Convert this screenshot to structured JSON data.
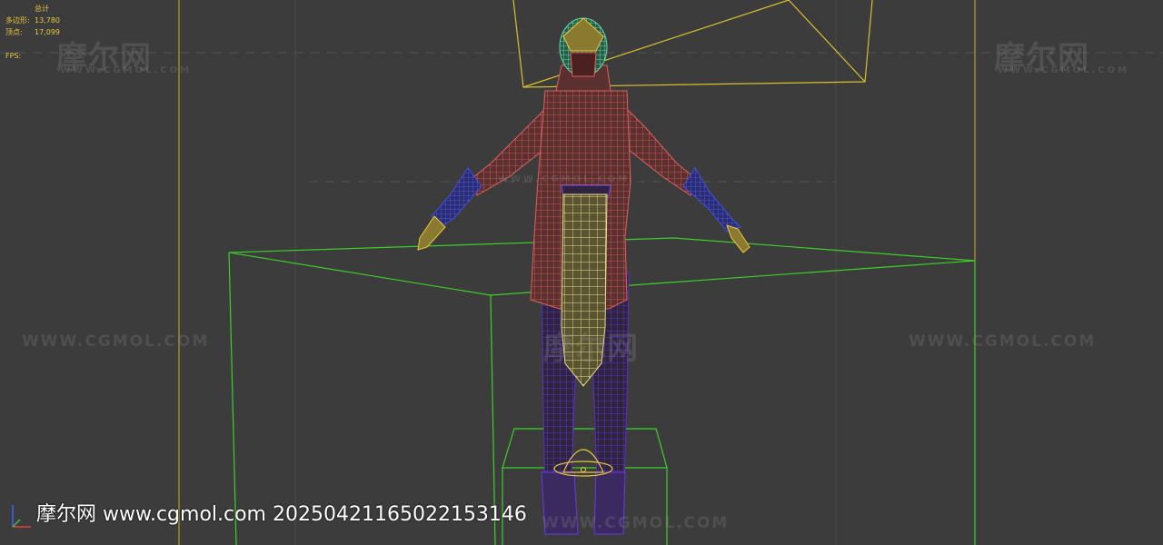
{
  "stats": {
    "header": "总计",
    "polygons_label": "多边形:",
    "polygons_value": "13,780",
    "vertices_label": "顶点:",
    "vertices_value": "17,099",
    "fps_label": "FPS:"
  },
  "watermark": {
    "logo": "摩尔网",
    "url_upper": "WWW.CGMOL.COM"
  },
  "caption": "摩尔网 www.cgmol.com 20250421165022153146",
  "colors": {
    "background": "#3c3c3c",
    "stats_text": "#e8c840",
    "bounding_box": "#3ccf2a",
    "camera_frame": "#d8c030",
    "torso_wire": "#e0605a",
    "skirt_wire": "#d8c870",
    "legs_wire": "#5a30c0",
    "gloves_wire": "#4050d8",
    "head_wire": "#60d8a8"
  }
}
